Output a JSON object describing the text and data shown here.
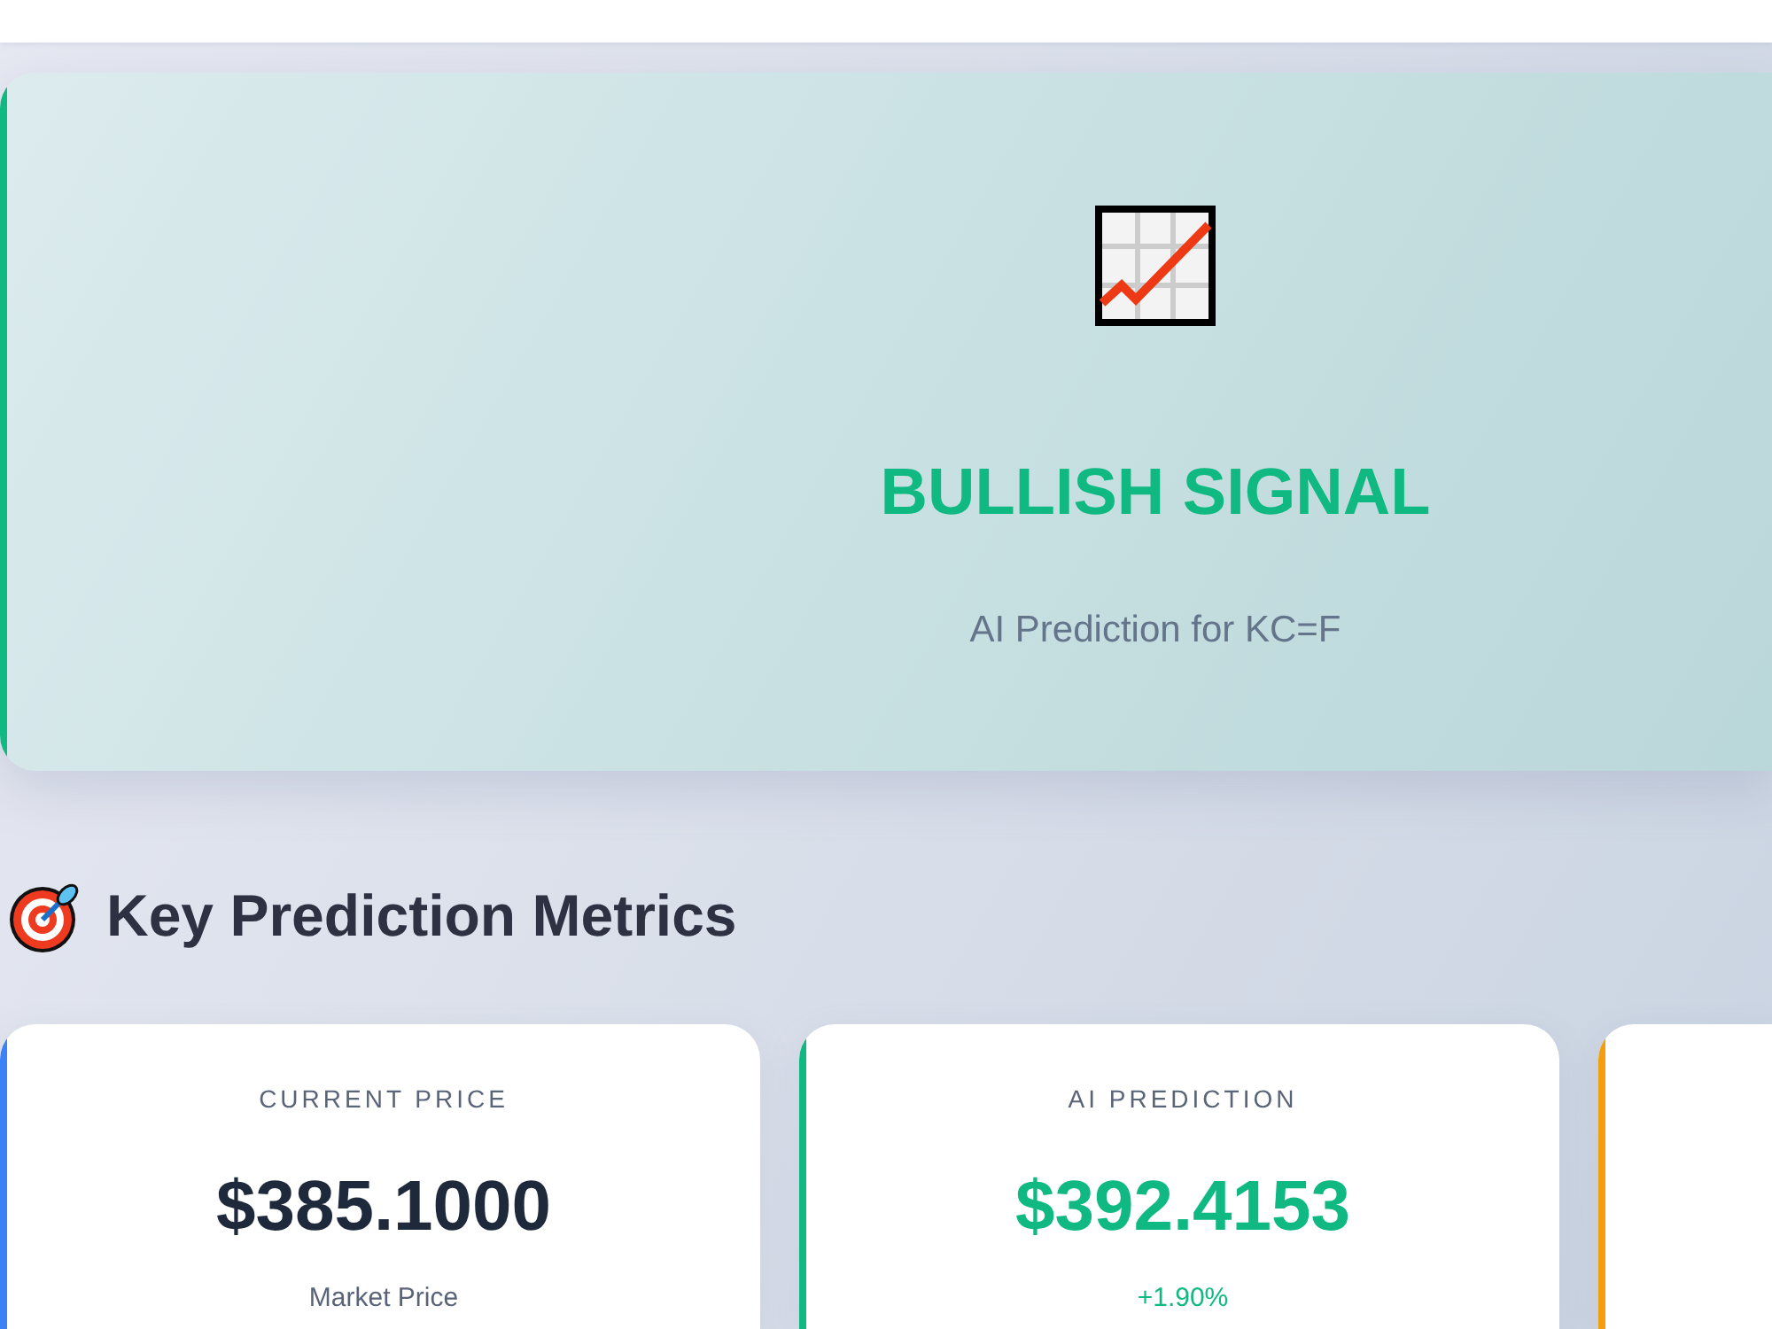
{
  "signal": {
    "kind": "bullish",
    "title": "BULLISH SIGNAL",
    "subtitle": "AI Prediction for KC=F"
  },
  "section": {
    "title": "Key Prediction Metrics"
  },
  "metrics": [
    {
      "kind": "neutral",
      "color": "#3b82f6",
      "label": "CURRENT PRICE",
      "value": "$385.1000",
      "note": "Market Price"
    },
    {
      "kind": "positive",
      "color": "#10b981",
      "label": "AI PREDICTION",
      "value": "$392.4153",
      "note": "+1.90%"
    },
    {
      "kind": "neutral",
      "color": "#f59e0b"
    }
  ]
}
